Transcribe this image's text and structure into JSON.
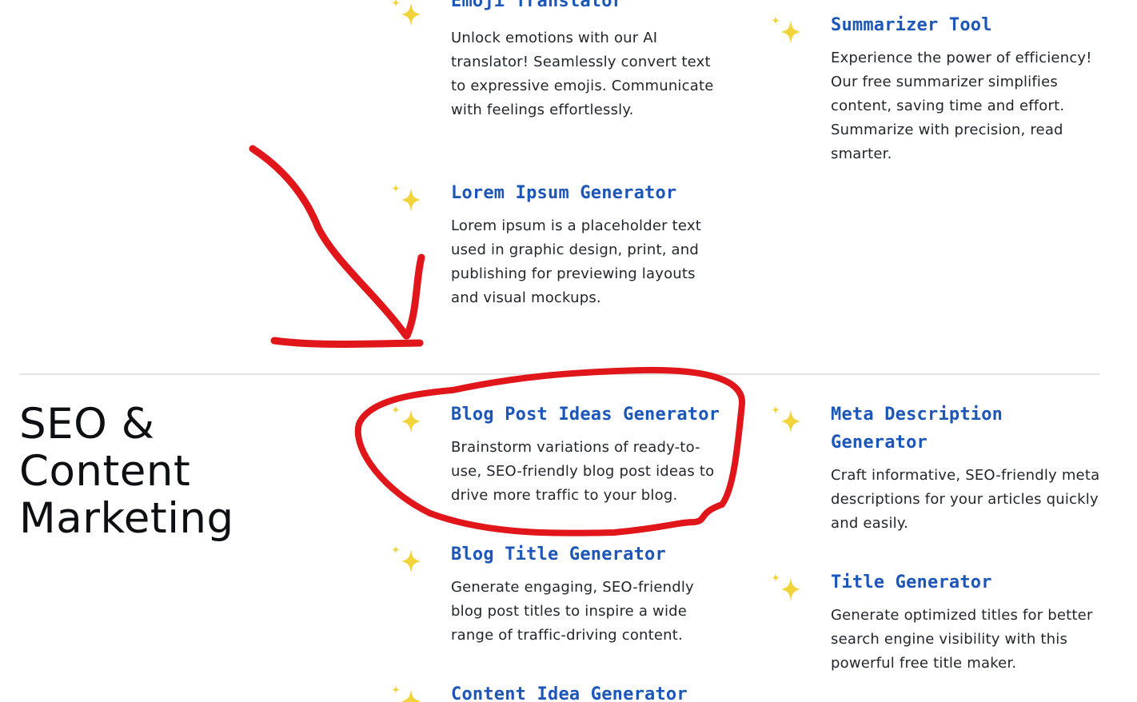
{
  "colors": {
    "title_link": "#1b56b8",
    "sparkle": "#f2d43a",
    "annotation": "#e0161b"
  },
  "tools": [
    {
      "title": "Emoji Translator",
      "description": "Unlock emotions with our AI translator! Seamlessly convert text to expressive emojis. Communicate with feelings effortlessly.",
      "icon": "sparkle-icon"
    },
    {
      "title": "Summarizer Tool",
      "description": "Experience the power of efficiency! Our free summarizer simplifies content, saving time and effort. Summarize with precision, read smarter.",
      "icon": "sparkle-icon"
    },
    {
      "title": "Lorem Ipsum Generator",
      "description": "Lorem ipsum is a placeholder text used in graphic design, print, and publishing for previewing layouts and visual mockups.",
      "icon": "sparkle-icon"
    }
  ],
  "seo_section": {
    "heading": "SEO & Content Marketing",
    "tools": [
      {
        "title": "Blog Post Ideas Generator",
        "description": "Brainstorm variations of ready-to-use, SEO-friendly blog post ideas to drive more traffic to your blog.",
        "icon": "sparkle-icon"
      },
      {
        "title": "Meta Description Generator",
        "description": "Craft informative, SEO-friendly meta descriptions for your articles quickly and easily.",
        "icon": "sparkle-icon"
      },
      {
        "title": "Blog Title Generator",
        "description": "Generate engaging, SEO-friendly blog post titles to inspire a wide range of traffic-driving content.",
        "icon": "sparkle-icon"
      },
      {
        "title": "Title Generator",
        "description": "Generate optimized titles for better search engine visibility with this powerful free title maker.",
        "icon": "sparkle-icon"
      },
      {
        "title": "Content Idea Generator",
        "description": "",
        "icon": "sparkle-icon"
      }
    ]
  },
  "annotations": {
    "arrow": "hand-drawn-arrow",
    "circle": "hand-drawn-circle"
  }
}
